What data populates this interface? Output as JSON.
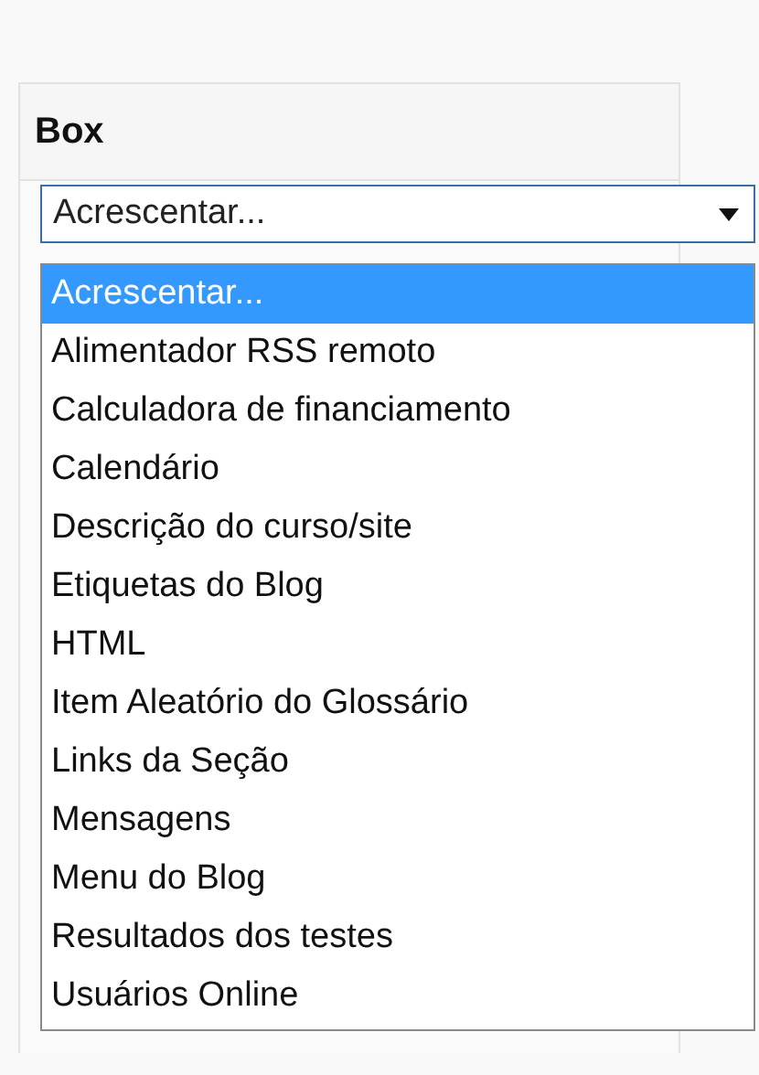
{
  "panel": {
    "title": "Box"
  },
  "select": {
    "value": "Acrescentar...",
    "expanded": true
  },
  "options": [
    {
      "label": "Acrescentar...",
      "selected": true
    },
    {
      "label": "Alimentador RSS remoto",
      "selected": false
    },
    {
      "label": "Calculadora de financiamento",
      "selected": false
    },
    {
      "label": "Calendário",
      "selected": false
    },
    {
      "label": "Descrição do curso/site",
      "selected": false
    },
    {
      "label": "Etiquetas do Blog",
      "selected": false
    },
    {
      "label": "HTML",
      "selected": false
    },
    {
      "label": "Item Aleatório do Glossário",
      "selected": false
    },
    {
      "label": "Links da Seção",
      "selected": false
    },
    {
      "label": "Mensagens",
      "selected": false
    },
    {
      "label": "Menu do Blog",
      "selected": false
    },
    {
      "label": "Resultados dos testes",
      "selected": false
    },
    {
      "label": "Usuários Online",
      "selected": false
    }
  ]
}
